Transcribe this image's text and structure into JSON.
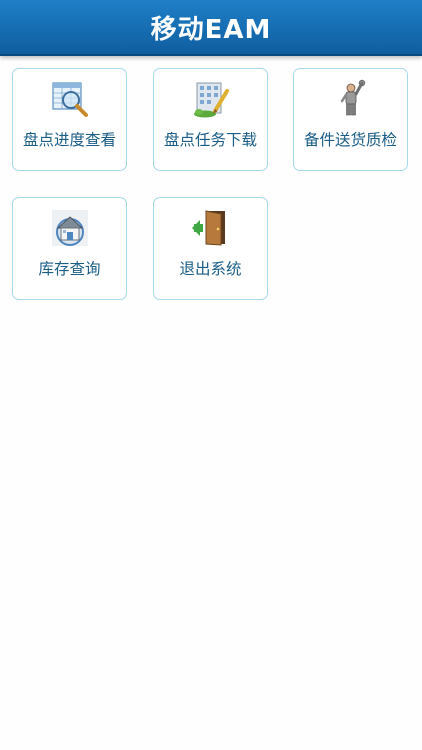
{
  "header": {
    "title": "移动EAM"
  },
  "menu": {
    "items": [
      {
        "label": "盘点进度查看",
        "icon": "magnifier-table-icon"
      },
      {
        "label": "盘点任务下载",
        "icon": "building-pencil-icon"
      },
      {
        "label": "备件送货质检",
        "icon": "worker-wrench-icon"
      },
      {
        "label": "库存查询",
        "icon": "warehouse-house-icon"
      },
      {
        "label": "退出系统",
        "icon": "exit-door-icon"
      }
    ]
  },
  "colors": {
    "header_bg": "#1670b8",
    "tile_border": "#a8d9ea",
    "label_text": "#1a5d86"
  }
}
